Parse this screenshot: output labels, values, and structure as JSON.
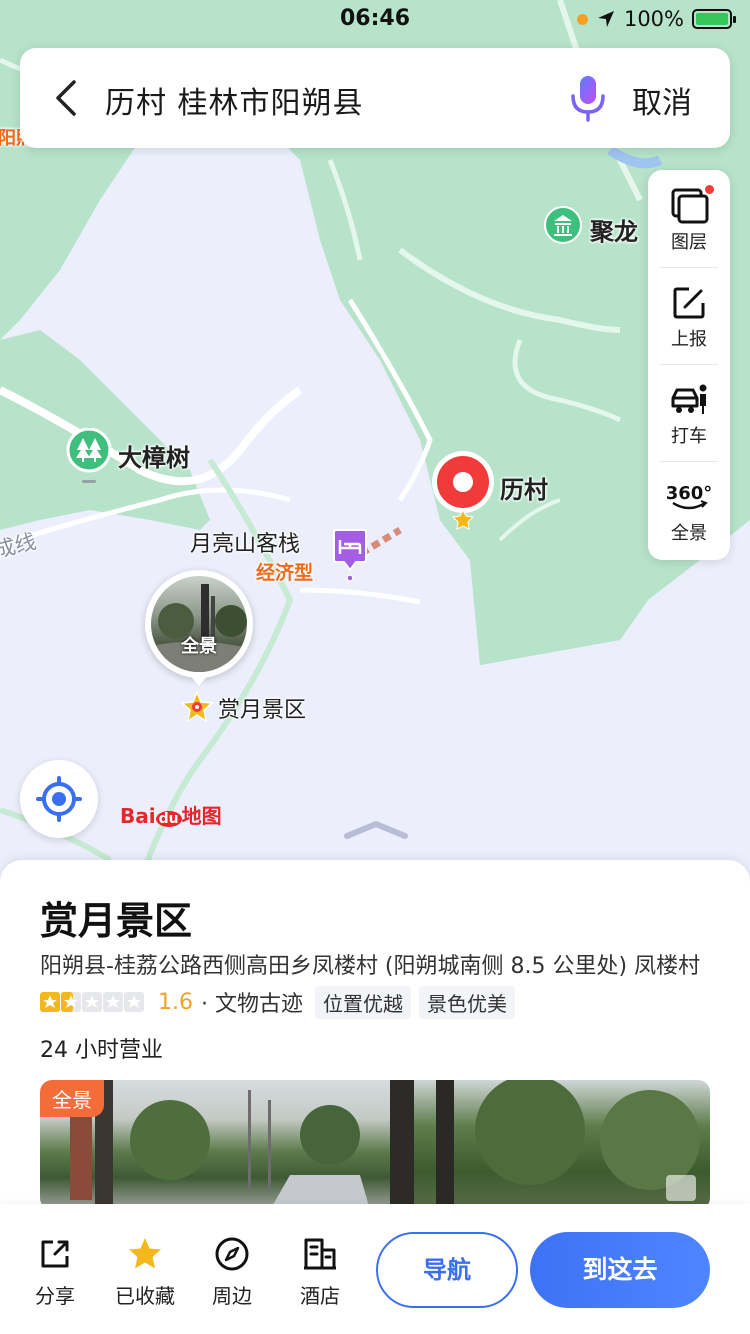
{
  "status_bar": {
    "time": "06:46",
    "battery": "100%"
  },
  "search": {
    "query": "历村 桂林市阳朔县",
    "cancel_label": "取消"
  },
  "toolbar": {
    "items": [
      {
        "label": "图层",
        "icon": "layers-icon"
      },
      {
        "label": "上报",
        "icon": "edit-report-icon"
      },
      {
        "label": "打车",
        "icon": "taxi-icon"
      },
      {
        "label": "全景",
        "icon": "panorama-360-icon"
      }
    ],
    "pano_360_text": "360°"
  },
  "map": {
    "labels": {
      "julong": "聚龙",
      "dazhangshu": "大樟树",
      "licun": "历村",
      "hotel": "月亮山客栈",
      "hotel_type": "经济型",
      "scenic": "赏月景区",
      "road_fragment": "成线",
      "left_fragment": "阳照"
    },
    "pano_thumb_label": "全景",
    "brand": {
      "bai": "Bai",
      "du": "du",
      "map": "地图"
    }
  },
  "place": {
    "name": "赏月景区",
    "address": "阳朔县-桂荔公路西侧高田乡凤楼村 (阳朔城南侧 8.5 公里处) 凤楼村",
    "rating": "1.6",
    "rating_value": 1.6,
    "rating_max": 5,
    "category": "· 文物古迹",
    "tags": [
      "位置优越",
      "景色优美"
    ],
    "hours": "24 小时营业",
    "photo_badge": "全景"
  },
  "actions": {
    "share": "分享",
    "favorite": "已收藏",
    "nearby": "周边",
    "hotel": "酒店",
    "navigate": "导航",
    "go": "到这去"
  },
  "colors": {
    "accent": "#3a6ff2",
    "green_area": "#b4e3c9",
    "road": "#ffffff",
    "rating": "#f0a22a"
  }
}
